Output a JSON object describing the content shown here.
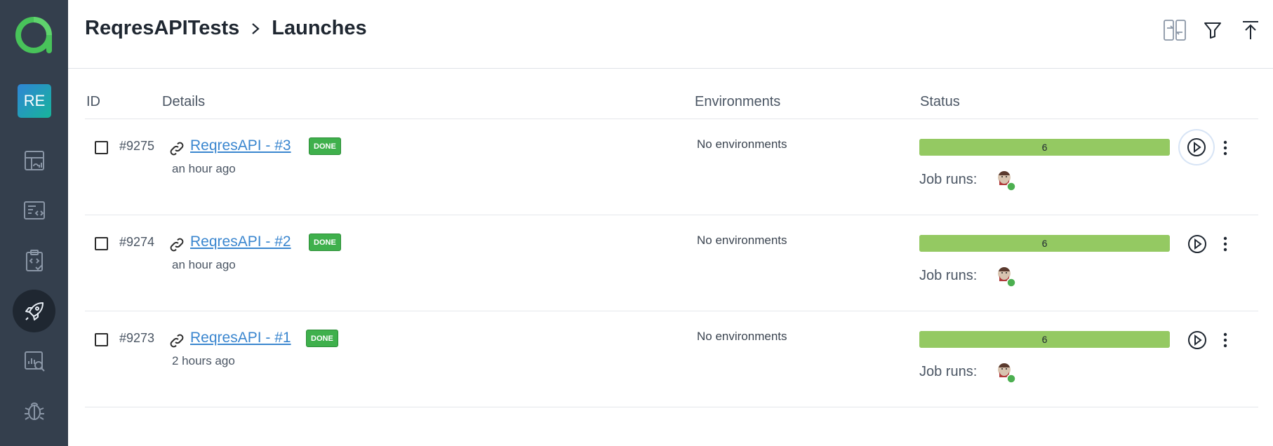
{
  "sidebar": {
    "logo_icon": "allure-logo-icon",
    "project_badge": "RE",
    "items": [
      {
        "icon": "dashboard-icon",
        "active": false
      },
      {
        "icon": "test-cases-icon",
        "active": false
      },
      {
        "icon": "test-plans-icon",
        "active": false
      },
      {
        "icon": "launches-rocket-icon",
        "active": true
      },
      {
        "icon": "analytics-search-icon",
        "active": false
      },
      {
        "icon": "defects-bug-icon",
        "active": false
      }
    ]
  },
  "header": {
    "project": "ReqresAPITests",
    "separator_icon": "chevron-right-icon",
    "page": "Launches",
    "actions": [
      "compare-icon",
      "filter-icon",
      "upload-icon"
    ]
  },
  "table": {
    "columns": {
      "id": "ID",
      "details": "Details",
      "environments": "Environments",
      "status": "Status"
    },
    "rows": [
      {
        "id": "#9275",
        "name": "ReqresAPI - #3",
        "badge": "DONE",
        "time": "an hour ago",
        "environments": "No environments",
        "progress_value": "6",
        "progress_fraction": 1.0,
        "job_runs_label": "Job runs:"
      },
      {
        "id": "#9274",
        "name": "ReqresAPI - #2",
        "badge": "DONE",
        "time": "an hour ago",
        "environments": "No environments",
        "progress_value": "6",
        "progress_fraction": 1.0,
        "job_runs_label": "Job runs:"
      },
      {
        "id": "#9273",
        "name": "ReqresAPI - #1",
        "badge": "DONE",
        "time": "2 hours ago",
        "environments": "No environments",
        "progress_value": "6",
        "progress_fraction": 1.0,
        "job_runs_label": "Job runs:"
      }
    ]
  },
  "colors": {
    "sidebar_bg": "#343f4d",
    "progress_passed": "#94c962",
    "done_badge": "#3fb04c",
    "link": "#3a86cf"
  }
}
